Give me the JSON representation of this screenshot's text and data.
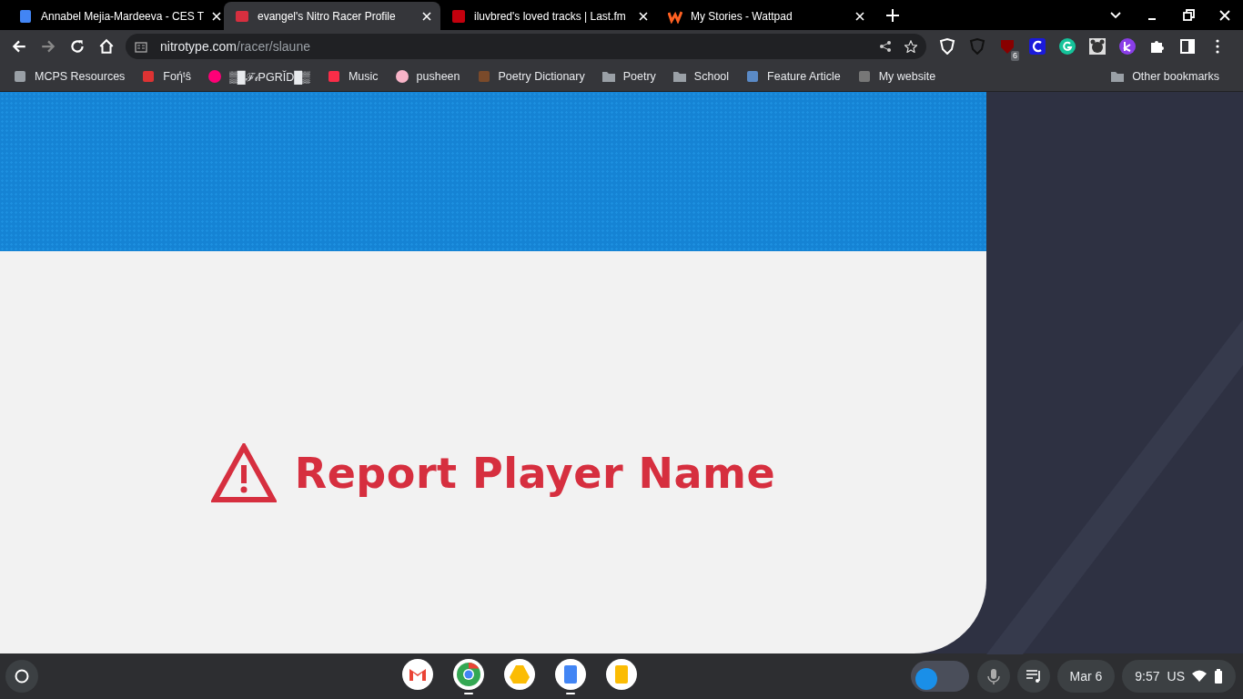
{
  "tabs": [
    {
      "title": "Annabel Mejia-Mardeeva - CES T",
      "kind": "docs",
      "selected": false
    },
    {
      "title": "evangel's Nitro Racer Profile",
      "kind": "nitro",
      "selected": true
    },
    {
      "title": "iluvbred's loved tracks | Last.fm",
      "kind": "lastfm",
      "selected": false
    },
    {
      "title": "My Stories - Wattpad",
      "kind": "wattpad",
      "selected": false
    }
  ],
  "address": {
    "domain": "nitrotype.com",
    "path": "/racer/slaune"
  },
  "extensions": [
    {
      "kind": "shield"
    },
    {
      "kind": "shield-dark"
    },
    {
      "kind": "ublock",
      "badge": "6"
    },
    {
      "kind": "c"
    },
    {
      "kind": "grammarly"
    },
    {
      "kind": "bear"
    },
    {
      "kind": "k"
    },
    {
      "kind": "puzzle"
    }
  ],
  "bookmarks": [
    {
      "label": "MCPS Resources",
      "kind": "building"
    },
    {
      "label": "Foήᵗŝ",
      "kind": "jar"
    },
    {
      "label": "▒█ℱ𝒾PGRĬD█▒",
      "kind": "blob"
    },
    {
      "label": "Music",
      "kind": "music"
    },
    {
      "label": "pusheen",
      "kind": "donut"
    },
    {
      "label": "Poetry Dictionary",
      "kind": "horse"
    },
    {
      "label": "Poetry",
      "kind": "folder"
    },
    {
      "label": "School",
      "kind": "folder"
    },
    {
      "label": "Feature Article",
      "kind": "spiral"
    },
    {
      "label": "My website",
      "kind": "cube"
    }
  ],
  "other_bookmarks": "Other bookmarks",
  "page": {
    "heading": "Report Player Name"
  },
  "shelf": {
    "apps": [
      {
        "kind": "gmail",
        "running": false
      },
      {
        "kind": "chrome",
        "running": true
      },
      {
        "kind": "drive",
        "running": false
      },
      {
        "kind": "docs",
        "running": true
      },
      {
        "kind": "slides",
        "running": false
      }
    ],
    "date": "Mar 6",
    "time": "9:57",
    "keyboard": "US"
  }
}
